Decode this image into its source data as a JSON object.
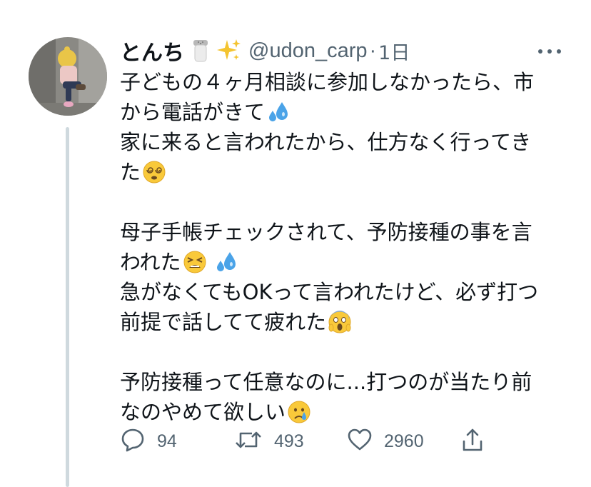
{
  "author": {
    "display_name": "とんち",
    "handle": "@udon_carp",
    "separator": "·",
    "time": "1日",
    "name_emojis": [
      "salt-shaker-emoji",
      "sparkles-emoji"
    ]
  },
  "tweet": {
    "lines": [
      {
        "text": "子どもの４ヶ月相談に参加しなかったら、市",
        "emoji": null
      },
      {
        "text": "から電話がきて",
        "emoji": "sweat-droplets"
      },
      {
        "text": "家に来ると言われたから、仕方なく行ってき",
        "emoji": null
      },
      {
        "text": "た",
        "emoji": "dizzy-face"
      },
      {
        "text": "",
        "emoji": null
      },
      {
        "text": "母子手帳チェックされて、予防接種の事を言",
        "emoji": null
      },
      {
        "text": "われた",
        "emoji": "tired-face+sweat-droplets"
      },
      {
        "text": "急がなくてもOKって言われたけど、必ず打つ",
        "emoji": null
      },
      {
        "text": "前提で話してて疲れた",
        "emoji": "screaming-face"
      },
      {
        "text": "",
        "emoji": null
      },
      {
        "text": "予防接種って任意なのに...打つのが当たり前",
        "emoji": null
      },
      {
        "text": "なのやめて欲しい",
        "emoji": "crying-face"
      }
    ]
  },
  "actions": {
    "reply_count": "94",
    "retweet_count": "493",
    "like_count": "2960"
  },
  "icons": {
    "reply": "speech-bubble-icon",
    "retweet": "retweet-icon",
    "like": "heart-icon",
    "share": "share-icon",
    "more": "more-dots-icon"
  },
  "colors": {
    "text": "#0f1419",
    "muted": "#536471",
    "thread_line": "#cfd9de"
  }
}
